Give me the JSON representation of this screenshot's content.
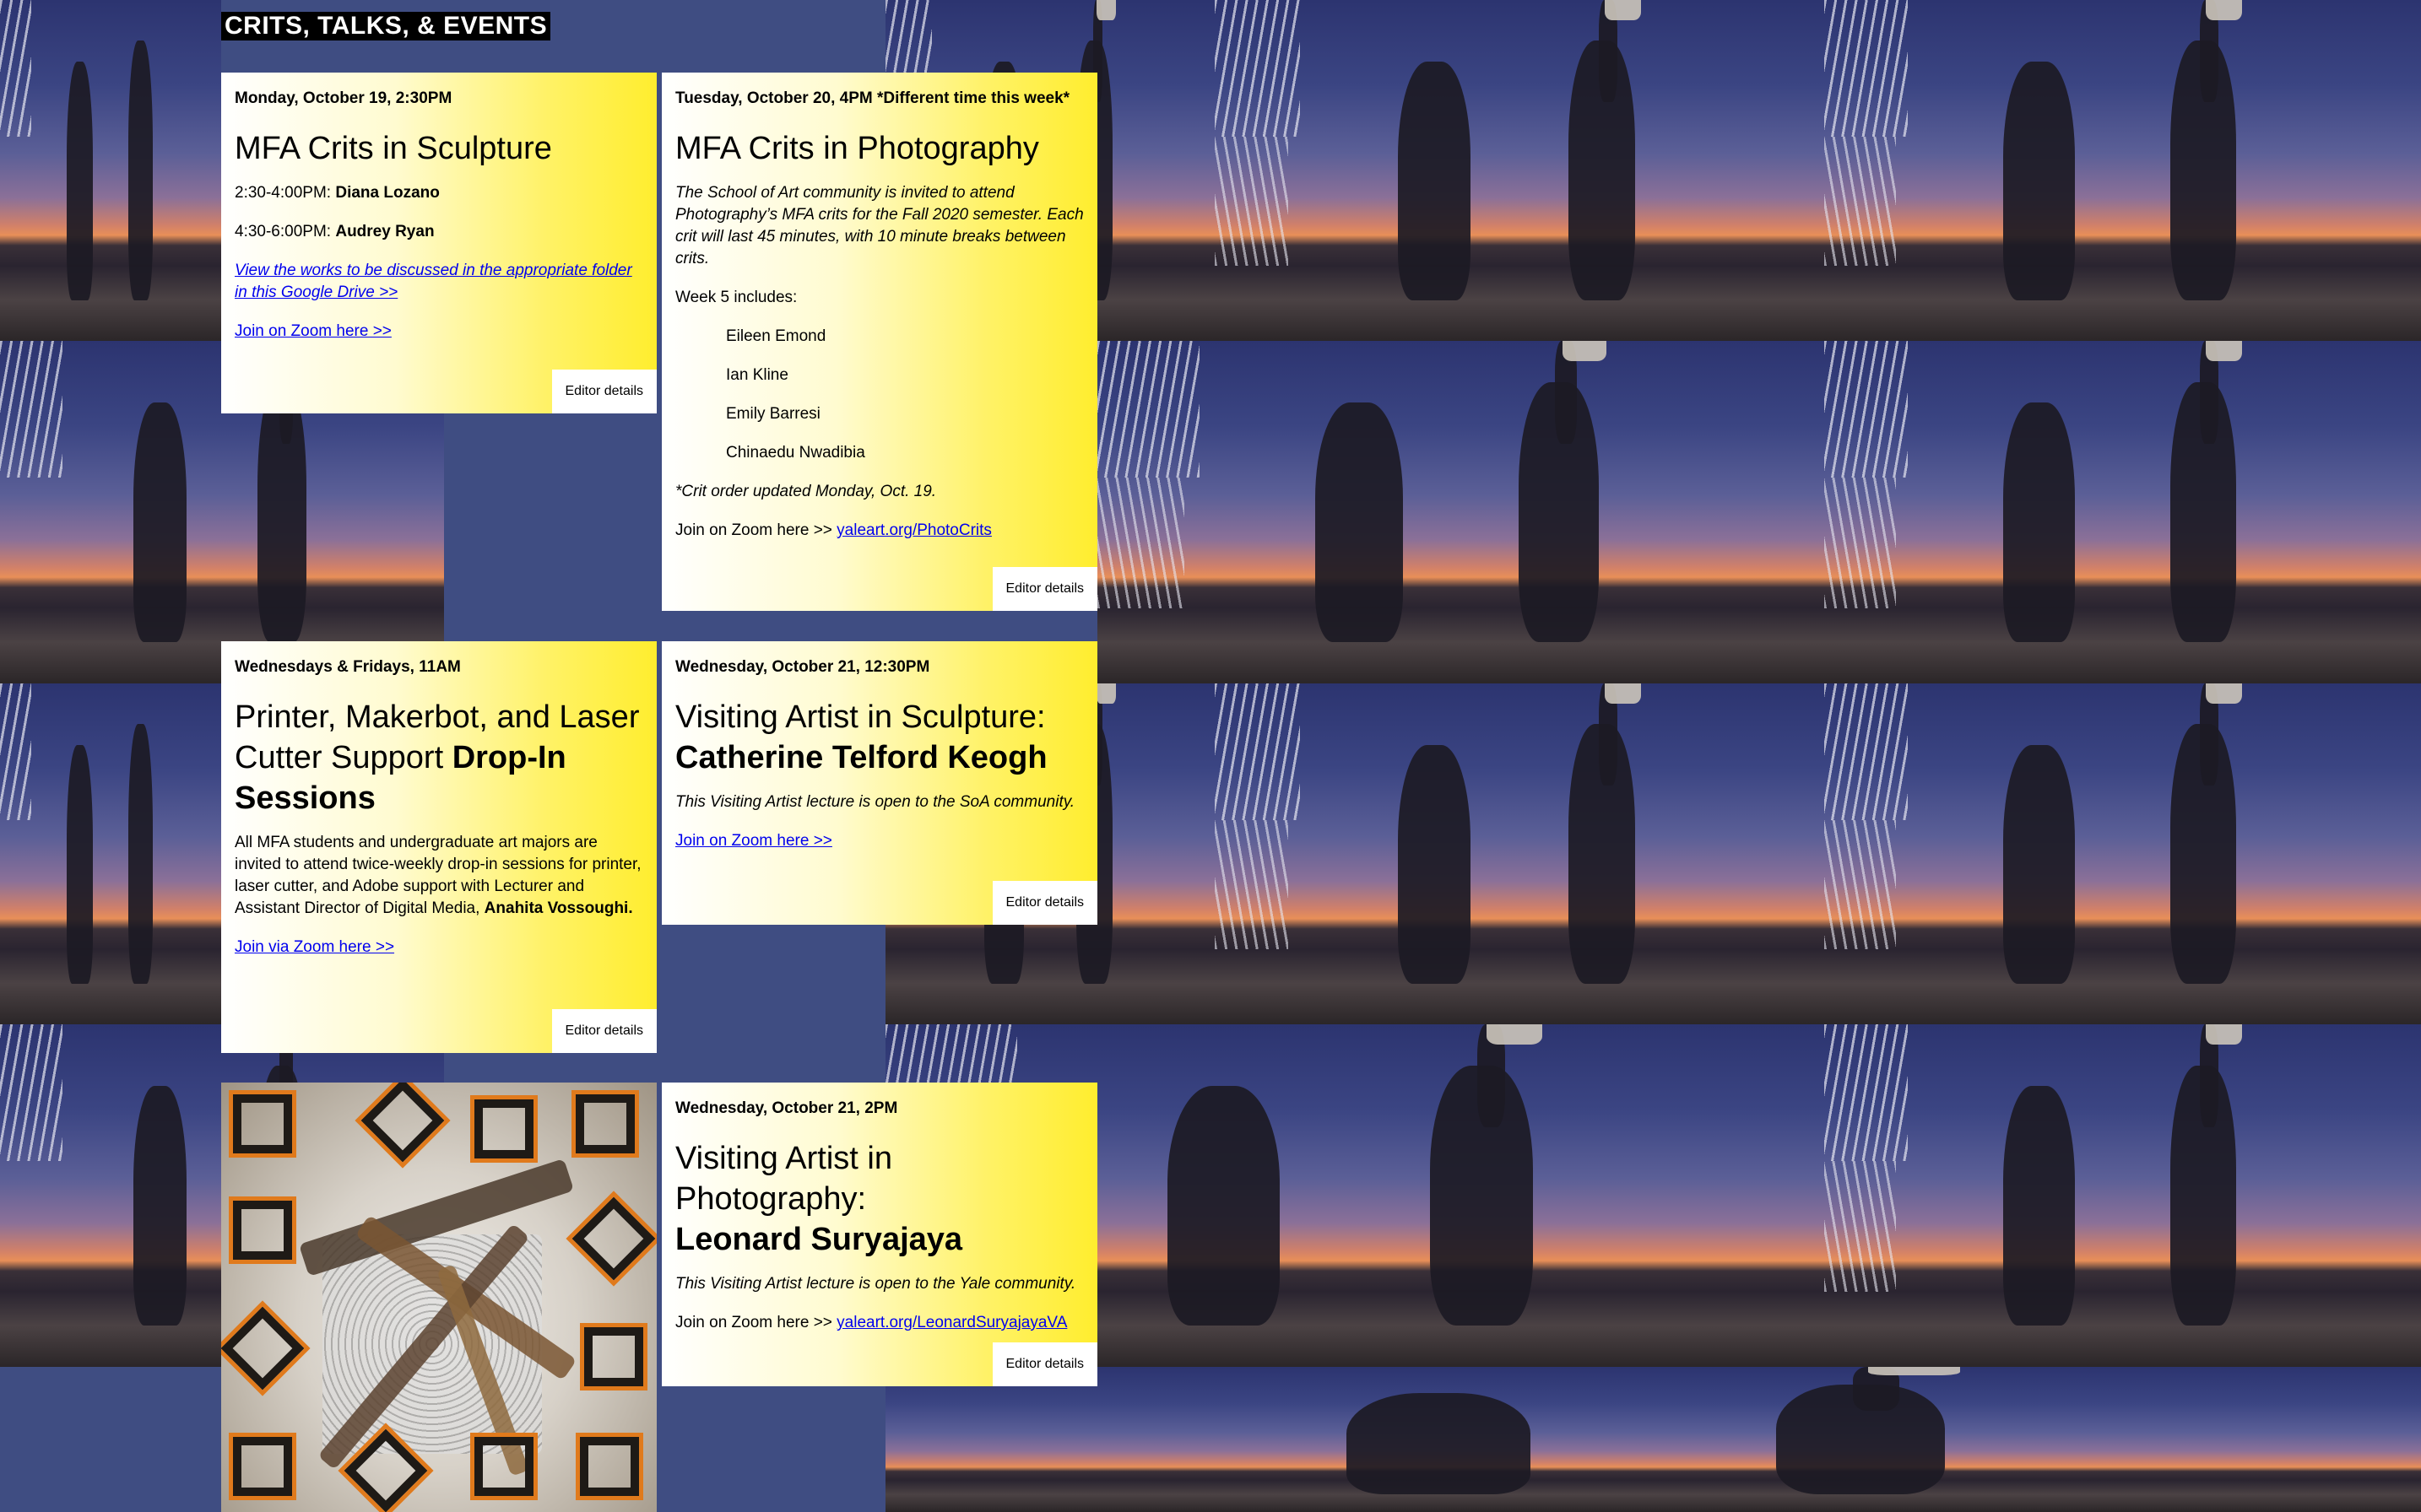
{
  "page": {
    "title": "CRITS, TALKS, & EVENTS"
  },
  "events": [
    {
      "date": "Monday, October 19, 2:30PM",
      "title": "MFA Crits in Sculpture",
      "slot1_time": "2:30-4:00PM: ",
      "slot1_name": "Diana Lozano",
      "slot2_time": "4:30-6:00PM: ",
      "slot2_name": "Audrey Ryan",
      "drive_link": "View the works to be discussed in the appropriate folder in this Google Drive >>",
      "zoom_link": "Join on Zoom here >>",
      "editor": "Editor details"
    },
    {
      "date": "Tuesday, October 20, 4PM *Different time this week*",
      "title": "MFA Crits in Photography",
      "intro": "The School of Art community is invited to attend Photography’s MFA crits for the Fall 2020 semester. Each crit will last 45 minutes, with 10 minute breaks between crits.",
      "week_label": "Week 5 includes:",
      "names": [
        "Eileen Emond",
        "Ian Kline",
        "Emily Barresi",
        "Chinaedu Nwadibia"
      ],
      "note": "*Crit order updated Monday, Oct. 19.",
      "zoom_prefix": "Join on Zoom here >> ",
      "zoom_link": "yaleart.org/PhotoCrits",
      "editor": "Editor details"
    },
    {
      "date": "Wednesdays & Fridays, 11AM",
      "title_plain": "Printer, Makerbot, and Laser Cutter Support ",
      "title_bold": "Drop-In Sessions",
      "body": "All MFA students and undergraduate art majors are invited to attend twice-weekly drop-in sessions for printer, laser cutter, and Adobe support with Lecturer and Assistant Director of Digital Media, ",
      "body_bold": "Anahita Vossoughi.",
      "zoom_link": "Join via Zoom here >>",
      "editor": "Editor details"
    },
    {
      "date": "Wednesday, October 21, 12:30PM",
      "title_plain": "Visiting Artist in Sculpture: ",
      "title_bold": "Catherine Telford Keogh",
      "body": "This Visiting Artist lecture is open to the SoA community.",
      "zoom_link": "Join on Zoom here >>",
      "editor": "Editor details"
    },
    {
      "date": "Wednesday, October 21, 2PM",
      "title_plain": "Visiting Artist in Photography: ",
      "title_bold": "Leonard Suryajaya",
      "body": "This Visiting Artist lecture is open to the Yale community.",
      "zoom_prefix": "Join on Zoom here >> ",
      "zoom_link": "yaleart.org/LeonardSuryajayaVA",
      "editor": "Editor details"
    }
  ],
  "colors": {
    "card_yellow": "#ffed2e",
    "background_blue": "#3f4d82",
    "link": "#0000ee"
  }
}
